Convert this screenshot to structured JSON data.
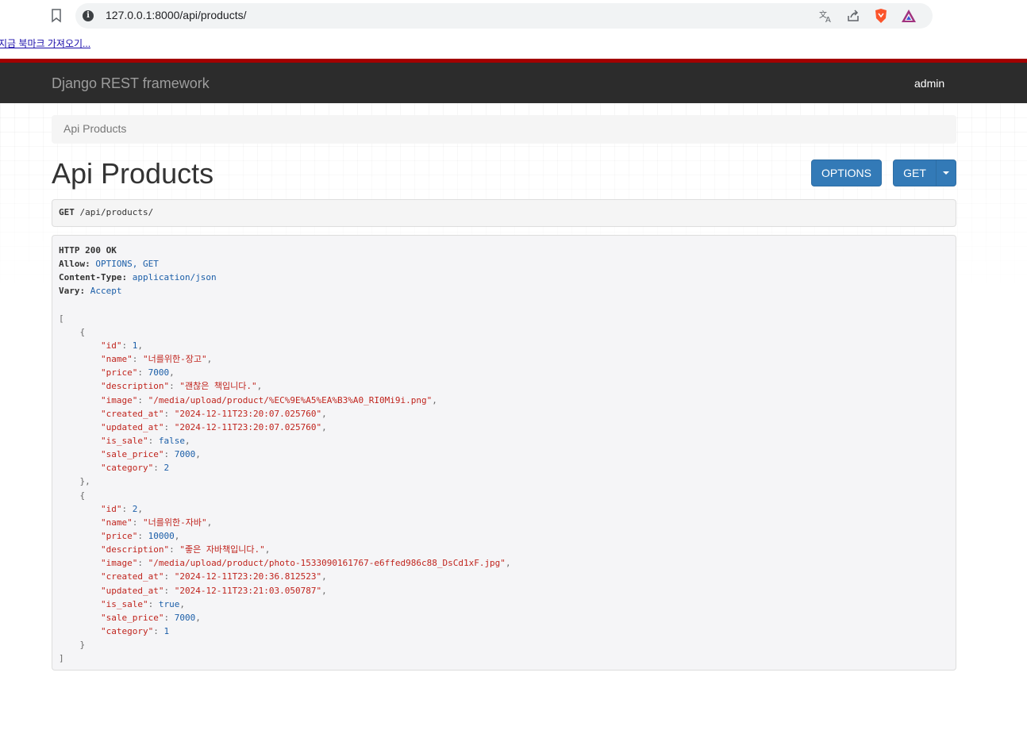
{
  "browser": {
    "url": "127.0.0.1:8000/api/products/",
    "bookmark_import_label": "지금 북마크 가져오기..."
  },
  "navbar": {
    "brand": "Django REST framework",
    "user": "admin"
  },
  "breadcrumb": {
    "current": "Api Products"
  },
  "page": {
    "title": "Api Products",
    "options_label": "OPTIONS",
    "get_label": "GET"
  },
  "request": {
    "method": "GET",
    "path": "/api/products/"
  },
  "response": {
    "status_line": "HTTP 200 OK",
    "headers": [
      {
        "key": "Allow:",
        "value": "OPTIONS, GET"
      },
      {
        "key": "Content-Type:",
        "value": "application/json"
      },
      {
        "key": "Vary:",
        "value": "Accept"
      }
    ],
    "products": [
      {
        "id": "1",
        "name": "\"너를위한-장고\"",
        "price": "7000",
        "description": "\"괜찮은 책입니다.\"",
        "image": "\"/media/upload/product/%EC%9E%A5%EA%B3%A0_RI0Mi9i.png\"",
        "created_at": "\"2024-12-11T23:20:07.025760\"",
        "updated_at": "\"2024-12-11T23:20:07.025760\"",
        "is_sale": "false",
        "sale_price": "7000",
        "category": "2"
      },
      {
        "id": "2",
        "name": "\"너를위한-자바\"",
        "price": "10000",
        "description": "\"좋은 자바책입니다.\"",
        "image": "\"/media/upload/product/photo-1533090161767-e6ffed986c88_DsCd1xF.jpg\"",
        "created_at": "\"2024-12-11T23:20:36.812523\"",
        "updated_at": "\"2024-12-11T23:21:03.050787\"",
        "is_sale": "true",
        "sale_price": "7000",
        "category": "1"
      }
    ]
  }
}
